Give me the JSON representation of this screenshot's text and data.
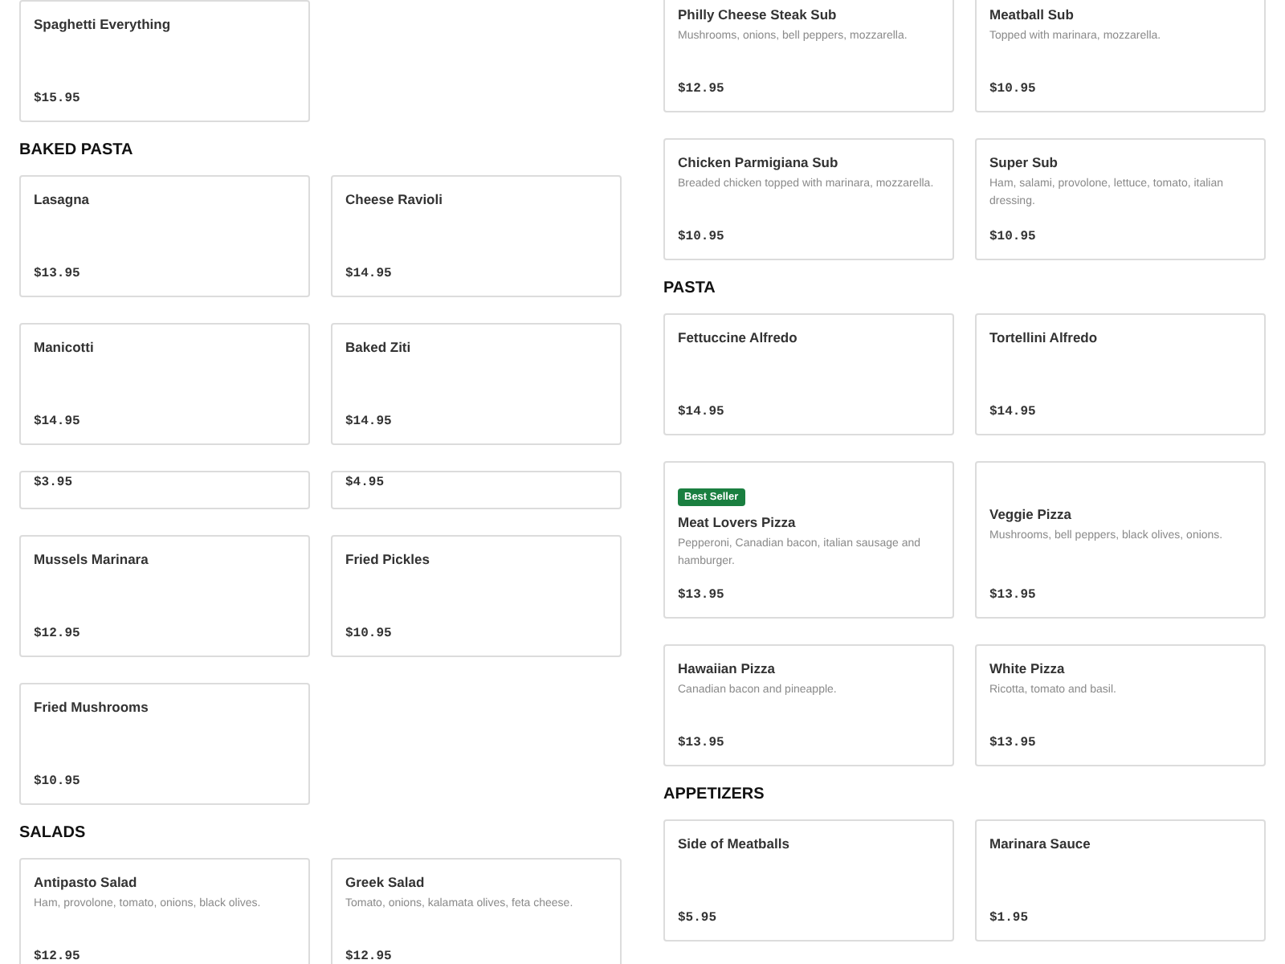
{
  "columns": [
    {
      "blocks": [
        {
          "kind": "grid",
          "cards": [
            {
              "name": "Spaghetti Everything",
              "price": "$15.95"
            }
          ]
        },
        {
          "kind": "heading",
          "text": "BAKED PASTA"
        },
        {
          "kind": "grid",
          "cards": [
            {
              "name": "Lasagna",
              "price": "$13.95"
            },
            {
              "name": "Cheese Ravioli",
              "price": "$14.95"
            },
            {
              "name": "Manicotti",
              "price": "$14.95"
            },
            {
              "name": "Baked Ziti",
              "price": "$14.95"
            }
          ]
        },
        {
          "kind": "partial",
          "cards": [
            {
              "price": "$3.95"
            },
            {
              "price": "$4.95"
            }
          ]
        },
        {
          "kind": "grid",
          "cards": [
            {
              "name": "Mussels Marinara",
              "price": "$12.95"
            },
            {
              "name": "Fried Pickles",
              "price": "$10.95"
            },
            {
              "name": "Fried Mushrooms",
              "price": "$10.95"
            }
          ]
        },
        {
          "kind": "heading",
          "text": "SALADS"
        },
        {
          "kind": "grid",
          "cards": [
            {
              "name": "Antipasto Salad",
              "description": "Ham, provolone, tomato, onions, black olives.",
              "price": "$12.95"
            },
            {
              "name": "Greek Salad",
              "description": "Tomato, onions, kalamata olives, feta cheese.",
              "price": "$12.95"
            }
          ]
        }
      ]
    },
    {
      "blocks": [
        {
          "kind": "grid",
          "cards": [
            {
              "name": "Philly Cheese Steak Sub",
              "description": "Mushrooms, onions, bell peppers, mozzarella.",
              "price": "$12.95"
            },
            {
              "name": "Meatball Sub",
              "description": "Topped with marinara, mozzarella.",
              "price": "$10.95"
            },
            {
              "name": "Chicken Parmigiana Sub",
              "description": "Breaded chicken topped with marinara, mozzarella.",
              "price": "$10.95"
            },
            {
              "name": "Super Sub",
              "description": "Ham, salami, provolone, lettuce, tomato, italian dressing.",
              "price": "$10.95"
            }
          ]
        },
        {
          "kind": "heading",
          "text": "PASTA"
        },
        {
          "kind": "grid",
          "cards": [
            {
              "name": "Fettuccine Alfredo",
              "price": "$14.95"
            },
            {
              "name": "Tortellini Alfredo",
              "price": "$14.95"
            }
          ]
        },
        {
          "kind": "grid",
          "cards": [
            {
              "badge": "Best Seller",
              "name": "Meat Lovers Pizza",
              "description": "Pepperoni, Canadian bacon, italian sausage and hamburger.",
              "price": "$13.95"
            },
            {
              "name": "Veggie Pizza",
              "description": "Mushrooms, bell peppers, black olives, onions.",
              "price": "$13.95"
            },
            {
              "name": "Hawaiian Pizza",
              "description": "Canadian bacon and pineapple.",
              "price": "$13.95"
            },
            {
              "name": "White Pizza",
              "description": "Ricotta, tomato and basil.",
              "price": "$13.95"
            }
          ]
        },
        {
          "kind": "heading",
          "text": "APPETIZERS"
        },
        {
          "kind": "grid",
          "cards": [
            {
              "name": "Side of Meatballs",
              "price": "$5.95"
            },
            {
              "name": "Marinara Sauce",
              "price": "$1.95"
            }
          ]
        }
      ]
    }
  ]
}
